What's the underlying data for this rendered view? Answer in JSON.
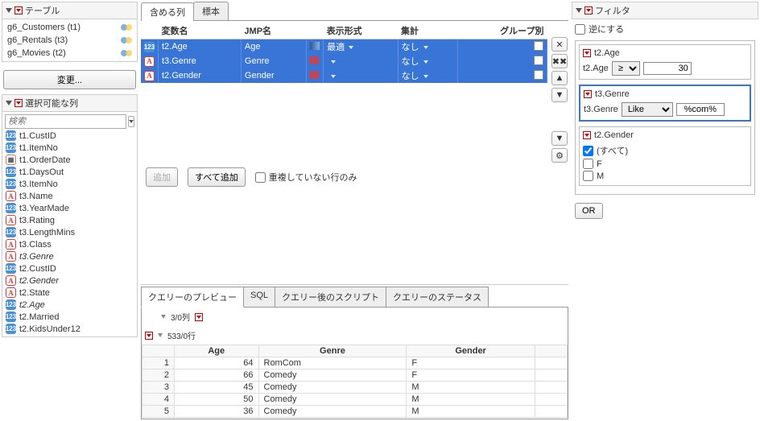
{
  "left": {
    "tables_header": "テーブル",
    "tables": [
      {
        "label": "g6_Customers (t1)"
      },
      {
        "label": "g6_Rentals (t3)"
      },
      {
        "label": "g6_Movies (t2)"
      }
    ],
    "change_button": "変更...",
    "columns_header": "選択可能な列",
    "search_placeholder": "検索",
    "columns": [
      {
        "type": "numeric",
        "label": "t1.CustID"
      },
      {
        "type": "numeric",
        "label": "t1.ItemNo"
      },
      {
        "type": "date",
        "label": "t1.OrderDate"
      },
      {
        "type": "numeric",
        "label": "t1.DaysOut"
      },
      {
        "type": "numeric",
        "label": "t3.ItemNo"
      },
      {
        "type": "char",
        "label": "t3.Name"
      },
      {
        "type": "numeric",
        "label": "t3.YearMade"
      },
      {
        "type": "char",
        "label": "t3.Rating"
      },
      {
        "type": "numeric",
        "label": "t3.LengthMins"
      },
      {
        "type": "char",
        "label": "t3.Class"
      },
      {
        "type": "char",
        "label": "t3.Genre",
        "italic": true
      },
      {
        "type": "numeric",
        "label": "t2.CustID"
      },
      {
        "type": "char",
        "label": "t2.Gender",
        "italic": true
      },
      {
        "type": "char",
        "label": "t2.State"
      },
      {
        "type": "numeric",
        "label": "t2.Age",
        "italic": true
      },
      {
        "type": "numeric",
        "label": "t2.Married"
      },
      {
        "type": "numeric",
        "label": "t2.KidsUnder12"
      }
    ]
  },
  "include": {
    "tabs": {
      "include": "含める列",
      "sample": "標本"
    },
    "grid": {
      "headers": {
        "var": "変数名",
        "jmp": "JMP名",
        "format": "表示形式",
        "agg": "集計",
        "group": "グループ別"
      },
      "rows": [
        {
          "type": "numeric",
          "var": "t2.Age",
          "jmp": "Age",
          "icon": "gradient",
          "format": "最適",
          "agg": "なし"
        },
        {
          "type": "char",
          "var": "t3.Genre",
          "jmp": "Genre",
          "icon": "bars",
          "format": "",
          "agg": "なし"
        },
        {
          "type": "char",
          "var": "t2.Gender",
          "jmp": "Gender",
          "icon": "bars",
          "format": "",
          "agg": "なし"
        }
      ]
    },
    "buttons": {
      "add": "追加",
      "add_all": "すべて追加",
      "distinct": "重複していない行のみ"
    }
  },
  "preview": {
    "tabs": {
      "preview": "クエリーのプレビュー",
      "sql": "SQL",
      "postscript": "クエリー後のスクリプト",
      "status": "クエリーのステータス"
    },
    "cols_meta": "3/0列",
    "rows_meta": "533/0行",
    "headers": [
      "Age",
      "Genre",
      "Gender"
    ],
    "rows": [
      {
        "n": 1,
        "age": 64,
        "genre": "RomCom",
        "gender": "F"
      },
      {
        "n": 2,
        "age": 66,
        "genre": "Comedy",
        "gender": "F"
      },
      {
        "n": 3,
        "age": 45,
        "genre": "Comedy",
        "gender": "M"
      },
      {
        "n": 4,
        "age": 50,
        "genre": "Comedy",
        "gender": "M"
      },
      {
        "n": 5,
        "age": 36,
        "genre": "Comedy",
        "gender": "M"
      }
    ]
  },
  "filter": {
    "header": "フィルタ",
    "invert": "逆にする",
    "age": {
      "title": "t2.Age",
      "label": "t2.Age",
      "op": "≥",
      "value": "30"
    },
    "genre": {
      "title": "t3.Genre",
      "label": "t3.Genre",
      "op": "Like",
      "value": "%com%"
    },
    "gender": {
      "title": "t2.Gender",
      "all": "(すべて)",
      "options": [
        "F",
        "M"
      ]
    },
    "or": "OR"
  }
}
